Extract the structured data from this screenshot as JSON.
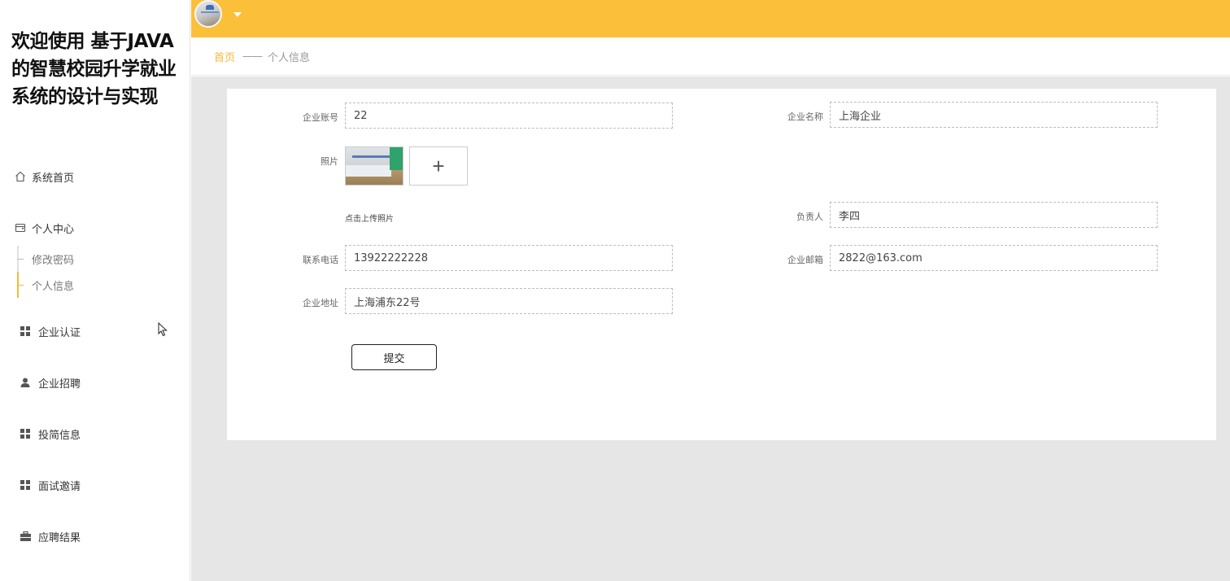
{
  "app": {
    "title": "欢迎使用 基于JAVA的智慧校园升学就业系统的设计与实现"
  },
  "sidebar": {
    "home": {
      "label": "系统首页",
      "icon": "home-icon"
    },
    "personal_center": {
      "label": "个人中心",
      "icon": "wallet-icon",
      "children": [
        {
          "label": "修改密码",
          "active": false
        },
        {
          "label": "个人信息",
          "active": true
        }
      ]
    },
    "items": [
      {
        "label": "企业认证",
        "icon": "grid-icon"
      },
      {
        "label": "企业招聘",
        "icon": "user-icon"
      },
      {
        "label": "投简信息",
        "icon": "grid-icon"
      },
      {
        "label": "面试邀请",
        "icon": "grid-icon"
      },
      {
        "label": "应聘结果",
        "icon": "briefcase-icon"
      }
    ]
  },
  "header": {
    "accent_color": "#fcbf39"
  },
  "breadcrumb": {
    "home": "首页",
    "separator": "——",
    "current": "个人信息"
  },
  "form": {
    "account": {
      "label": "企业账号",
      "value": "22"
    },
    "company_name": {
      "label": "企业名称",
      "value": "上海企业"
    },
    "photo": {
      "label": "照片",
      "upload_hint": "点击上传照片",
      "add_symbol": "+"
    },
    "manager": {
      "label": "负责人",
      "value": "李四"
    },
    "phone": {
      "label": "联系电话",
      "value": "13922222228"
    },
    "email": {
      "label": "企业邮箱",
      "value": "2822@163.com"
    },
    "address": {
      "label": "企业地址",
      "value": "上海浦东22号"
    },
    "submit_label": "提交"
  }
}
